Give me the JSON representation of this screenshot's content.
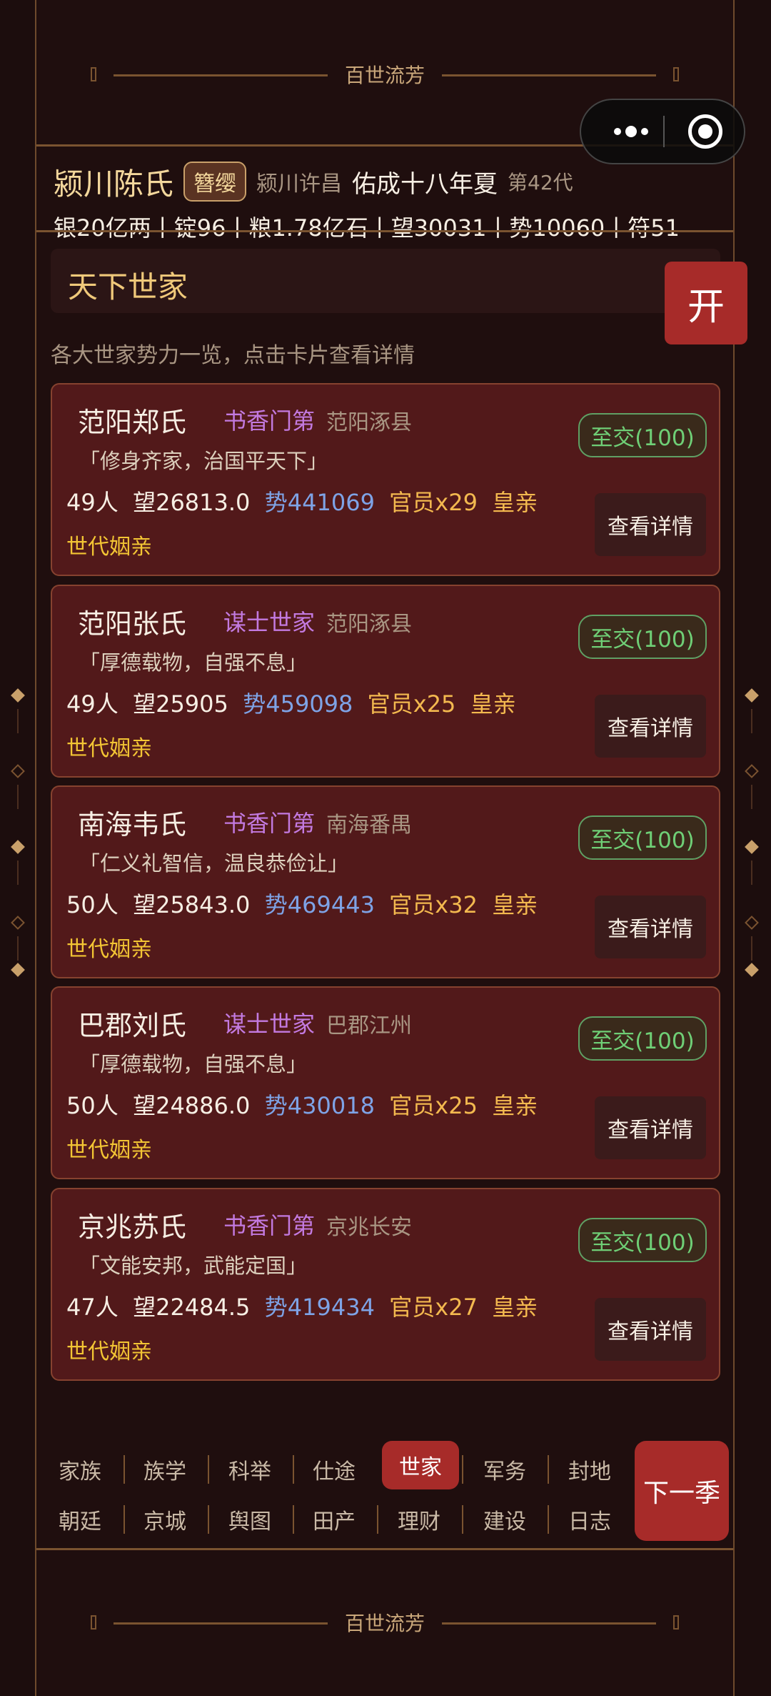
{
  "banner_title": "百世流芳",
  "status": {
    "clan_name": "颍川陈氏",
    "rank_badge": "簪缨",
    "origin": "颍川许昌",
    "era": "佑成十八年夏",
    "generation": "第42代",
    "resources": "银20亿两丨锭96丨粮1.78亿石丨望30031丨势10060丨符51"
  },
  "section": {
    "title": "天下世家",
    "subtitle": "各大世家势力一览，点击卡片查看详情",
    "open_label": "开"
  },
  "families": [
    {
      "name": "范阳郑氏",
      "type": "书香门第",
      "place": "范阳涿县",
      "motto": "「修身齐家，治国平天下」",
      "people": "49人",
      "prestige": "望26813.0",
      "power": "势441069",
      "officials": "官员x29",
      "royal": "皇亲",
      "marriage": "世代姻亲",
      "relation": "至交(100)",
      "detail_label": "查看详情"
    },
    {
      "name": "范阳张氏",
      "type": "谋士世家",
      "place": "范阳涿县",
      "motto": "「厚德载物，自强不息」",
      "people": "49人",
      "prestige": "望25905",
      "power": "势459098",
      "officials": "官员x25",
      "royal": "皇亲",
      "marriage": "世代姻亲",
      "relation": "至交(100)",
      "detail_label": "查看详情"
    },
    {
      "name": "南海韦氏",
      "type": "书香门第",
      "place": "南海番禺",
      "motto": "「仁义礼智信，温良恭俭让」",
      "people": "50人",
      "prestige": "望25843.0",
      "power": "势469443",
      "officials": "官员x32",
      "royal": "皇亲",
      "marriage": "世代姻亲",
      "relation": "至交(100)",
      "detail_label": "查看详情"
    },
    {
      "name": "巴郡刘氏",
      "type": "谋士世家",
      "place": "巴郡江州",
      "motto": "「厚德载物，自强不息」",
      "people": "50人",
      "prestige": "望24886.0",
      "power": "势430018",
      "officials": "官员x25",
      "royal": "皇亲",
      "marriage": "世代姻亲",
      "relation": "至交(100)",
      "detail_label": "查看详情"
    },
    {
      "name": "京兆苏氏",
      "type": "书香门第",
      "place": "京兆长安",
      "motto": "「文能安邦，武能定国」",
      "people": "47人",
      "prestige": "望22484.5",
      "power": "势419434",
      "officials": "官员x27",
      "royal": "皇亲",
      "marriage": "世代姻亲",
      "relation": "至交(100)",
      "detail_label": "查看详情"
    }
  ],
  "nav": {
    "row1": [
      "家族",
      "族学",
      "科举",
      "仕途",
      "世家",
      "军务",
      "封地"
    ],
    "row2": [
      "朝廷",
      "京城",
      "舆图",
      "田产",
      "理财",
      "建设",
      "日志"
    ],
    "active": "世家",
    "next_label": "下一季"
  }
}
